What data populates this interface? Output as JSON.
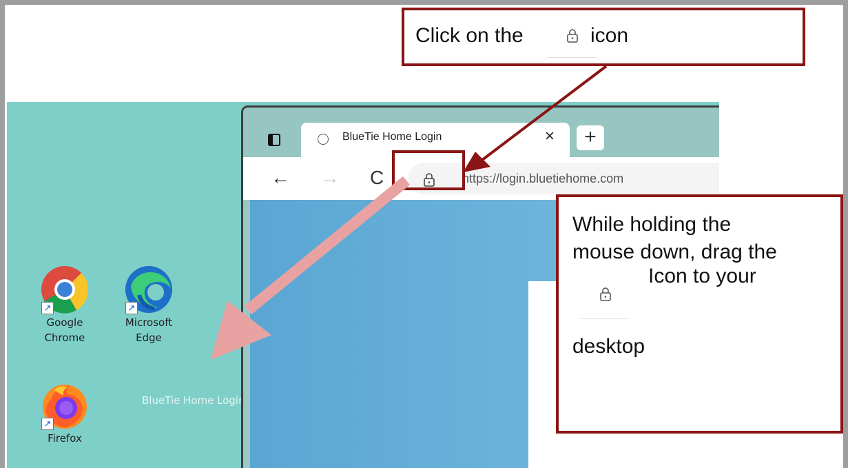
{
  "callout_top": {
    "before_icon": "Click on the",
    "after_icon": "icon"
  },
  "callout_right": {
    "line1": "While holding the",
    "line2": "mouse down, drag the",
    "line3": "Icon to your",
    "line4": "desktop"
  },
  "browser": {
    "tab_title": "BlueTie Home Login",
    "close_glyph": "×",
    "newtab_glyph": "+",
    "back_glyph": "←",
    "forward_glyph": "→",
    "refresh_glyph": "C",
    "url": "https://login.bluetiehome.com"
  },
  "desktop": {
    "icons": [
      {
        "line1": "Google",
        "line2": "Chrome"
      },
      {
        "line1": "Microsoft",
        "line2": "Edge"
      },
      {
        "line1": "Firefox",
        "line2": ""
      }
    ],
    "drag_ghost_label": "BlueTie Home Login"
  },
  "colors": {
    "callout_border": "#8b1414",
    "arrow_dark": "#8b1414",
    "arrow_light": "#e8a2a2",
    "desktop_bg": "#7fcfc9"
  },
  "icons": [
    "lock-icon",
    "chrome-icon",
    "edge-icon",
    "firefox-icon",
    "shortcut-arrow-icon"
  ]
}
